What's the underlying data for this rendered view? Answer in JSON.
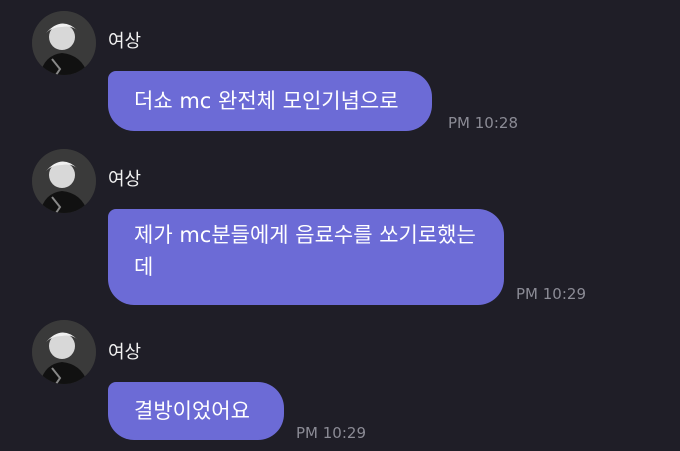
{
  "chat": {
    "messages": [
      {
        "sender": "여상",
        "text": "더쇼 mc 완전체 모인기념으로",
        "time": "PM 10:28"
      },
      {
        "sender": "여상",
        "text": "제가 mc분들에게 음료수를 쏘기로했는데",
        "time": "PM 10:29"
      },
      {
        "sender": "여상",
        "text": "결방이었어요",
        "time": "PM 10:29"
      }
    ]
  },
  "colors": {
    "background": "#1f1e27",
    "bubble": "#6c6bd6",
    "bubble_text": "#ffffff",
    "timestamp": "#8b8b95",
    "sender": "#f2f2f2"
  }
}
